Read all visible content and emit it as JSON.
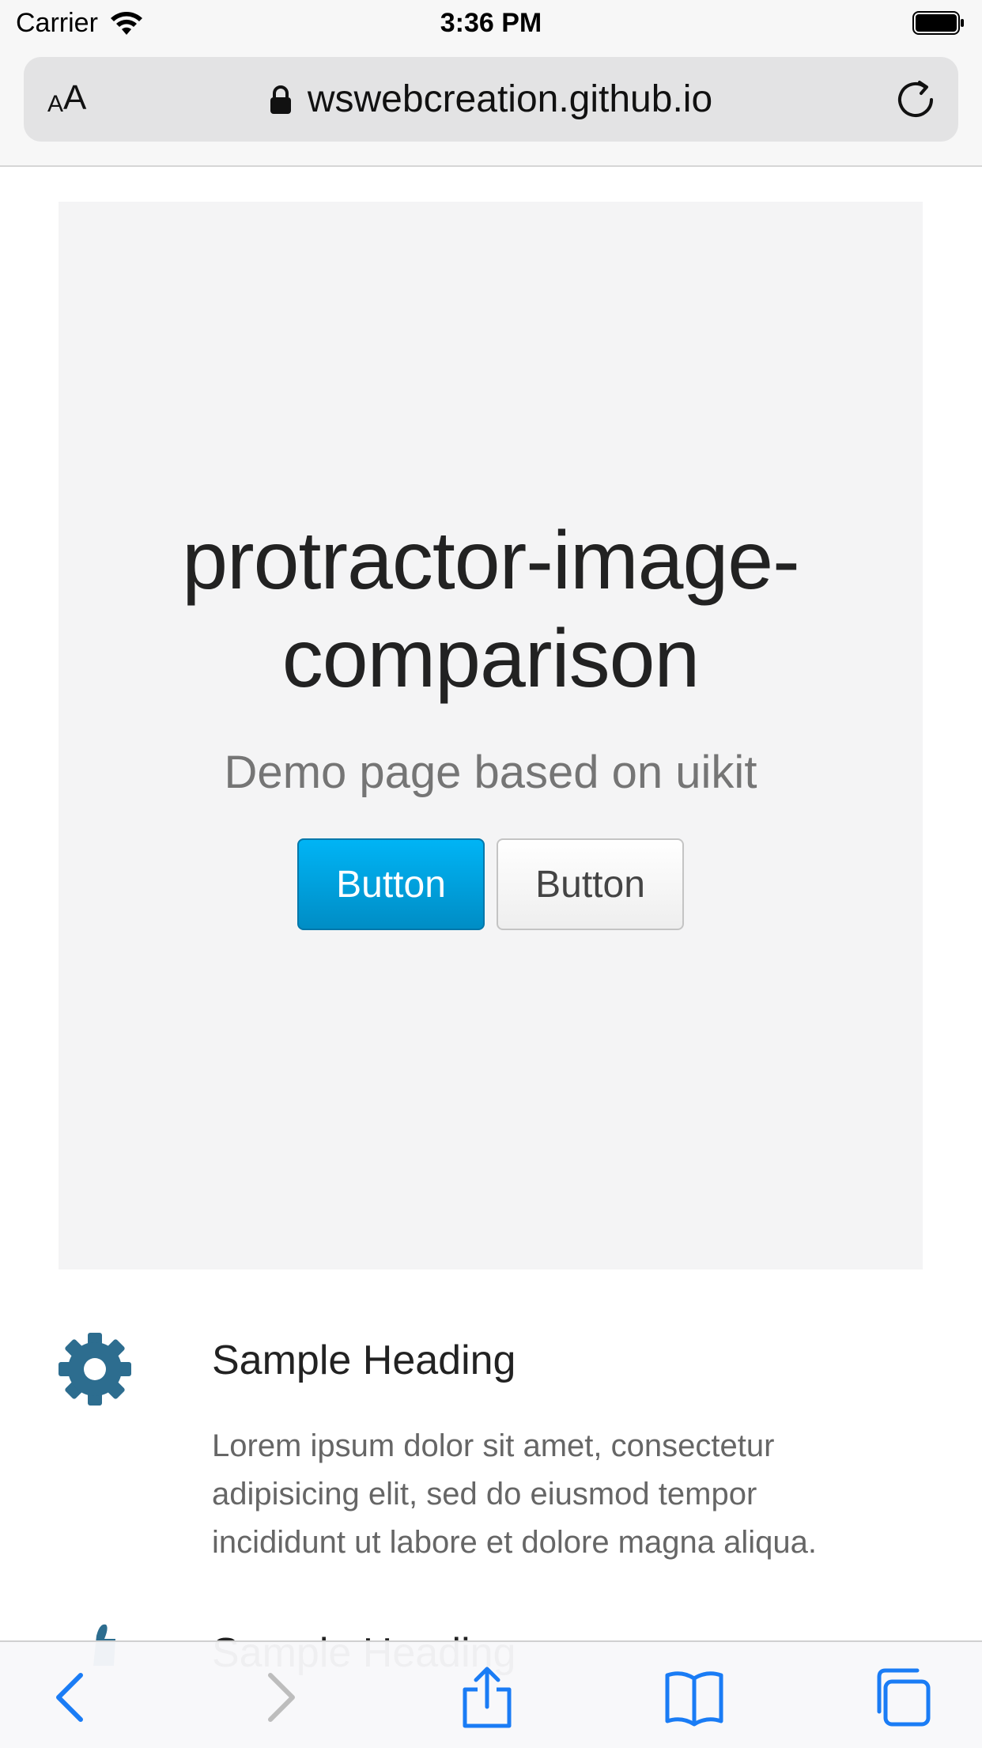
{
  "status_bar": {
    "carrier": "Carrier",
    "time": "3:36 PM"
  },
  "browser": {
    "text_size_small": "A",
    "text_size_large": "A",
    "url": "wswebcreation.github.io"
  },
  "hero": {
    "title_line1": "protractor-image-",
    "title_line2": "comparison",
    "subtitle": "Demo page based on uikit",
    "primary_button": "Button",
    "default_button": "Button"
  },
  "features": [
    {
      "icon": "gear-icon",
      "heading": "Sample Heading",
      "text_line1": "Lorem ipsum dolor sit amet, consectetur",
      "text_line2": "adipisicing elit, sed do eiusmod tempor",
      "text_line3": "incididunt ut labore et dolore magna aliqua."
    },
    {
      "icon": "thumbs-up-icon",
      "heading": "Sample Heading"
    }
  ],
  "colors": {
    "accent": "#00a8e6",
    "icon": "#2d6d8f",
    "toolbar_active": "#1a7cf5",
    "toolbar_disabled": "#bdbdbd"
  },
  "toolbar": [
    "back-icon",
    "forward-icon",
    "share-icon",
    "bookmarks-icon",
    "tabs-icon"
  ]
}
